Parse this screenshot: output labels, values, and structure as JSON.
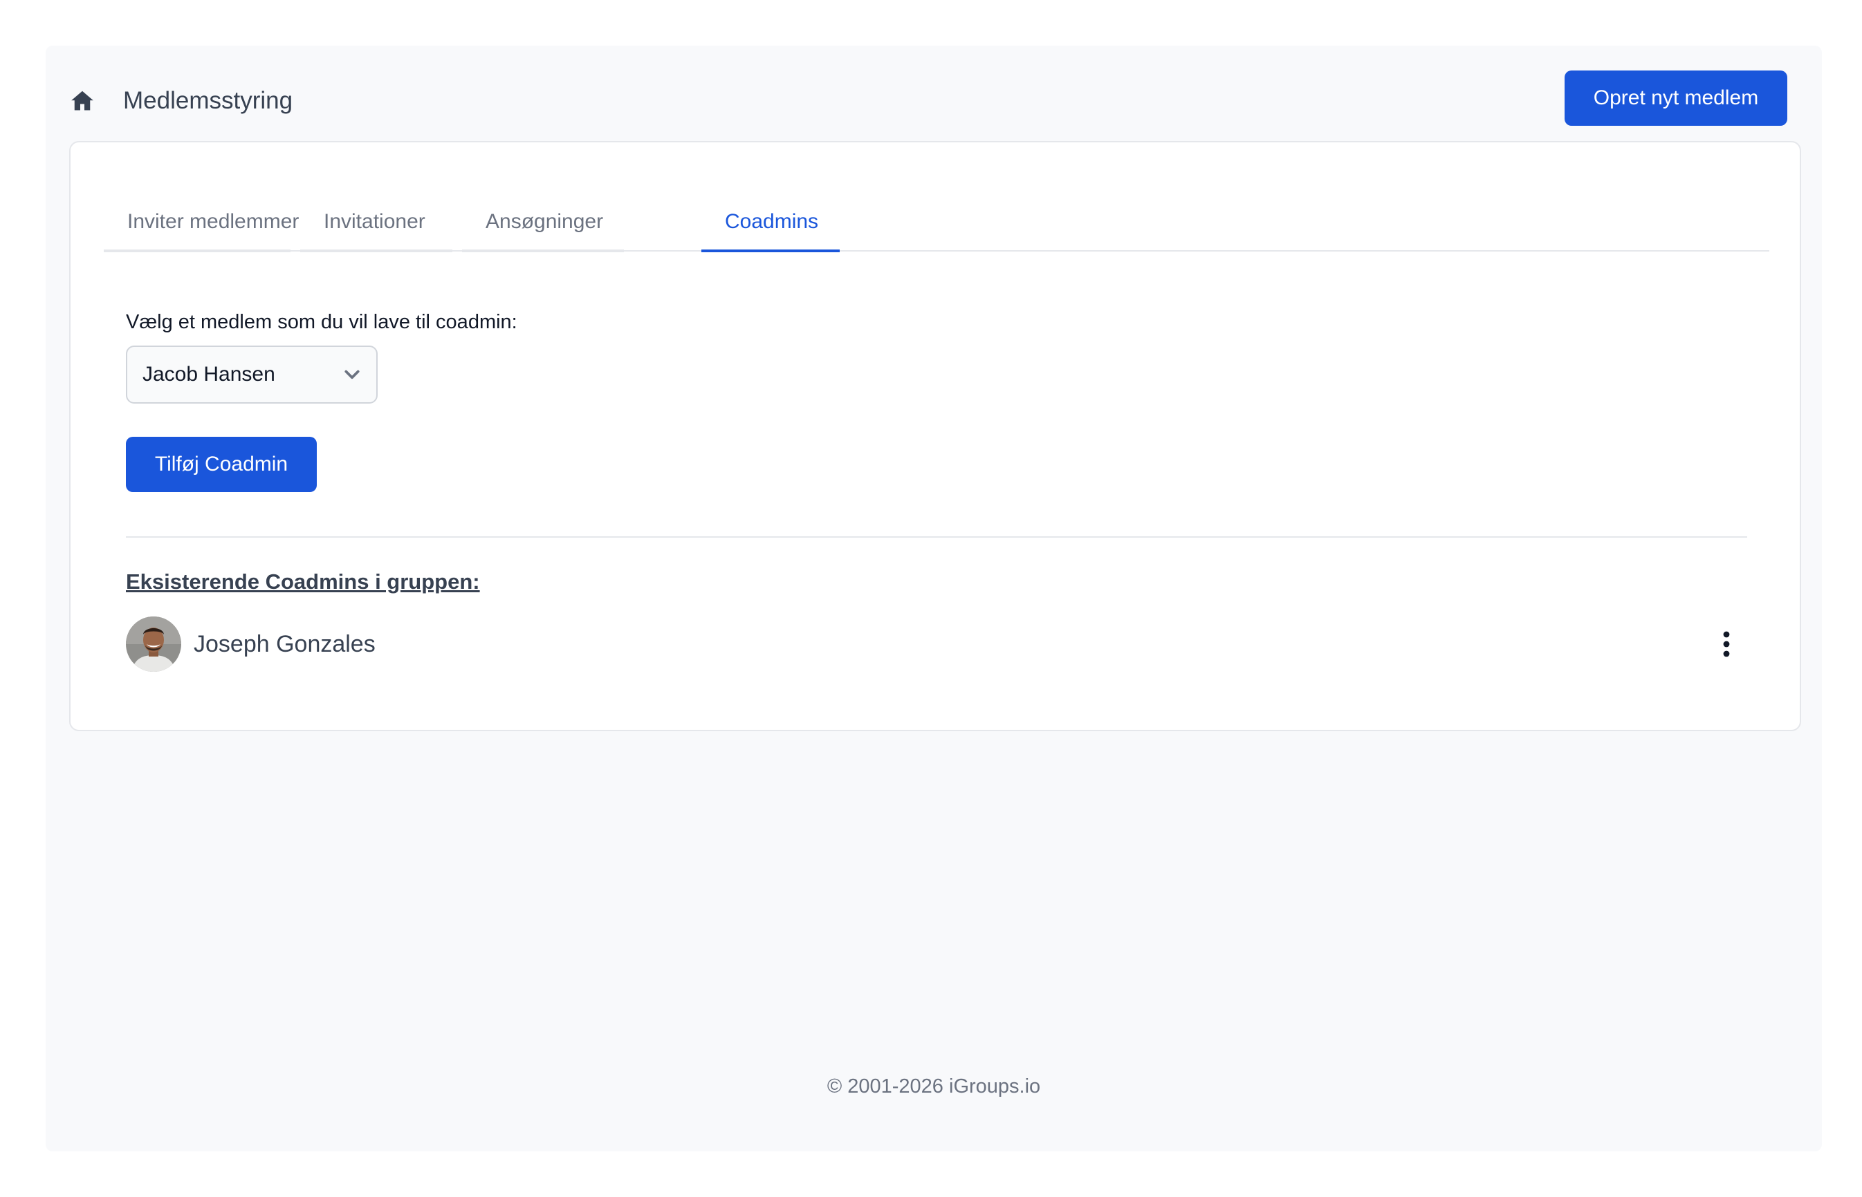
{
  "header": {
    "title": "Medlemsstyring",
    "home_icon": "home-icon",
    "create_member_label": "Opret nyt medlem"
  },
  "tabs": [
    {
      "label": "Inviter medlemmer",
      "active": false
    },
    {
      "label": "Invitationer",
      "active": false
    },
    {
      "label": "Ansøgninger",
      "active": false
    },
    {
      "label": "Coadmins",
      "active": true
    }
  ],
  "coadmin_form": {
    "select_label": "Vælg et medlem som du vil lave til coadmin:",
    "selected_member": "Jacob Hansen",
    "add_button_label": "Tilføj Coadmin"
  },
  "existing": {
    "heading": "Eksisterende Coadmins i gruppen:",
    "coadmins": [
      {
        "name": "Joseph Gonzales"
      }
    ]
  },
  "footer": {
    "copyright": "© 2001-2026 iGroups.io"
  },
  "colors": {
    "accent": "#1a56db",
    "background": "#f8f9fb",
    "text": "#374151",
    "muted": "#6b7280",
    "border": "#e5e7eb"
  }
}
